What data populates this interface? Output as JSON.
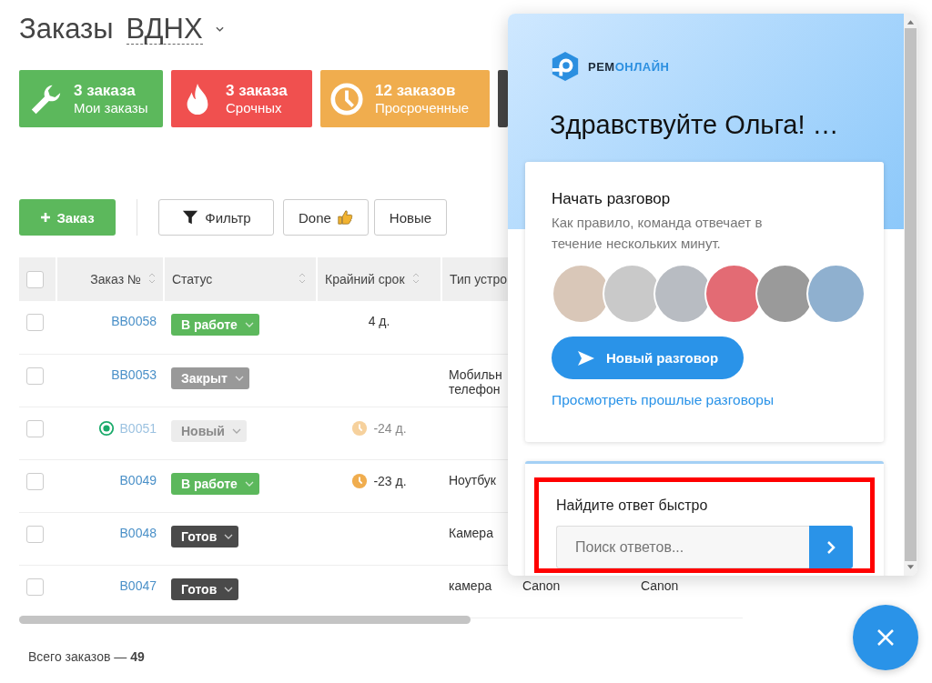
{
  "header": {
    "title": "Заказы",
    "location": "ВДНХ"
  },
  "stat_cards": [
    {
      "kind": "mine",
      "count": "3 заказа",
      "label": "Мои заказы"
    },
    {
      "kind": "urgent",
      "count": "3 заказа",
      "label": "Срочных"
    },
    {
      "kind": "overdue",
      "count": "12 заказов",
      "label": "Просроченные"
    },
    {
      "kind": "dark"
    }
  ],
  "toolbar": {
    "add_button": "Заказ",
    "filter_button": "Фильтр",
    "presets": [
      {
        "label": "Done",
        "thumb": true
      },
      {
        "label": "Новые",
        "thumb": false
      }
    ]
  },
  "table": {
    "all_checked": false,
    "columns": [
      {
        "label": "Заказ №",
        "sortable": true
      },
      {
        "label": "Статус",
        "sortable": true
      },
      {
        "label": "Крайний срок",
        "sortable": true
      },
      {
        "label": "Тип устро",
        "sortable": false
      }
    ],
    "rows": [
      {
        "checked": false,
        "dimmed": false,
        "marker": false,
        "order": "BB0058",
        "status": {
          "label": "В работе",
          "kind": "in_progress"
        },
        "deadline": "4 д.",
        "overdue": false,
        "device_type": "",
        "column_6": "",
        "column_7": ""
      },
      {
        "checked": false,
        "dimmed": false,
        "marker": false,
        "order": "BB0053",
        "status": {
          "label": "Закрыт",
          "kind": "closed"
        },
        "deadline": "",
        "overdue": false,
        "device_type": "Мобильн телефон",
        "column_6": "",
        "column_7": ""
      },
      {
        "checked": false,
        "dimmed": true,
        "marker": true,
        "order": "B0051",
        "status": {
          "label": "Новый",
          "kind": "new"
        },
        "deadline": "-24 д.",
        "overdue": true,
        "device_type": "",
        "column_6": "",
        "column_7": ""
      },
      {
        "checked": false,
        "dimmed": false,
        "marker": false,
        "order": "B0049",
        "status": {
          "label": "В работе",
          "kind": "in_progress"
        },
        "deadline": "-23 д.",
        "overdue": true,
        "device_type": "Ноутбук",
        "column_6": "",
        "column_7": ""
      },
      {
        "checked": false,
        "dimmed": false,
        "marker": false,
        "order": "B0048",
        "status": {
          "label": "Готов",
          "kind": "ready"
        },
        "deadline": "",
        "overdue": false,
        "device_type": "Камера",
        "column_6": "",
        "column_7": ""
      },
      {
        "checked": false,
        "dimmed": false,
        "marker": false,
        "order": "B0047",
        "status": {
          "label": "Готов",
          "kind": "ready"
        },
        "deadline": "",
        "overdue": false,
        "device_type": "камера",
        "column_6": "Canon",
        "column_7": "Canon"
      }
    ]
  },
  "footer": {
    "total": "Всего заказов — **49**"
  },
  "chat": {
    "logo": {
      "prefix": "РЕМ",
      "suffix": "ОНЛАЙН"
    },
    "greeting": "Здравствуйте Ольга! …",
    "start_title": "Начать разговор",
    "start_text": "Как правило, команда отвечает в течение нескольких минут.",
    "avatars": [
      {
        "color": "#d9c7b8"
      },
      {
        "color": "#c9c9c9"
      },
      {
        "color": "#b8bcc2"
      },
      {
        "color": "#e36b74"
      },
      {
        "color": "#9a9a9a"
      },
      {
        "color": "#8fb0cf"
      }
    ],
    "new_button": "Новый разговор",
    "past_link": "Просмотреть прошлые разговоры",
    "search_title": "Найдите ответ быстро",
    "search_placeholder": "Поиск ответов...",
    "highlighted": true
  }
}
